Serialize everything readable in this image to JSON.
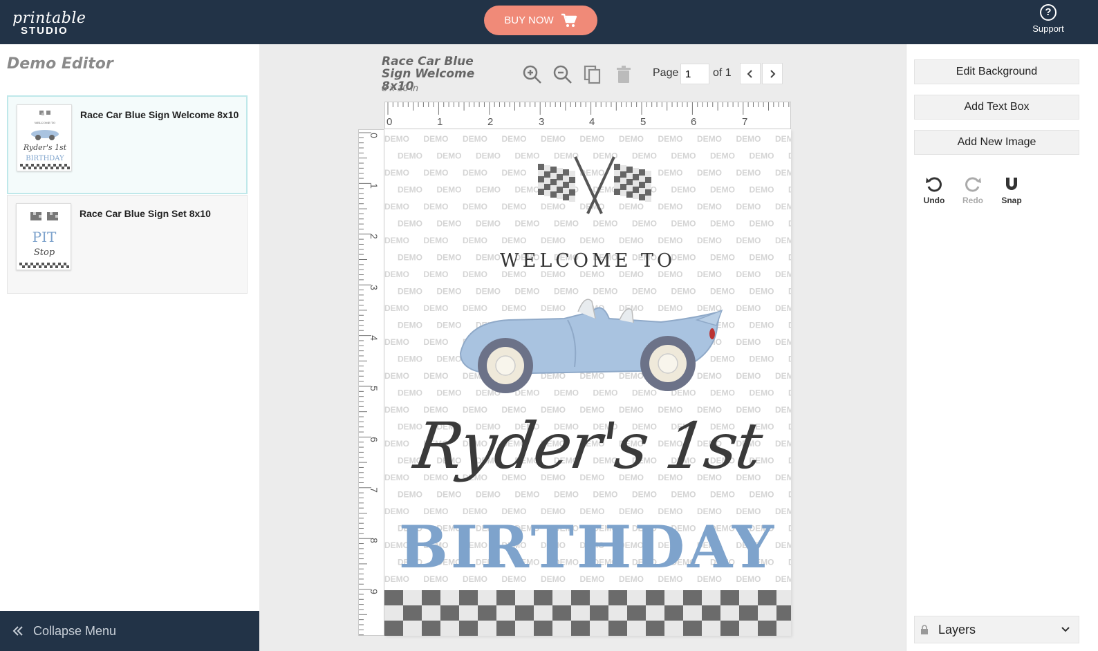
{
  "header": {
    "logo_script": "printable",
    "logo_word": "STUDIO",
    "buy_label": "BUY NOW",
    "support_label": "Support"
  },
  "sidebar": {
    "title": "Demo Editor",
    "templates": [
      {
        "name": "Race Car Blue Sign Welcome 8x10",
        "thumb_lines": [
          "WELCOME TO",
          "Ryder's 1st",
          "BIRTHDAY"
        ]
      },
      {
        "name": "Race Car Blue Sign Set 8x10",
        "thumb_lines": [
          "PIT",
          "Stop"
        ]
      }
    ],
    "collapse_label": "Collapse Menu"
  },
  "editor": {
    "doc_title": "Race Car Blue Sign Welcome 8x10",
    "doc_size": "8 x 10 in",
    "page_label": "Page",
    "page_value": "1",
    "page_of": "of 1",
    "ruler_h": [
      "0",
      "1",
      "2",
      "3",
      "4",
      "5",
      "6",
      "7"
    ],
    "ruler_v": [
      "0",
      "1",
      "2",
      "3",
      "4",
      "5",
      "6",
      "7",
      "8",
      "9"
    ],
    "watermark": "DEMO"
  },
  "canvas": {
    "welcome": "WELCOME TO",
    "name_line": "Ryder's 1st",
    "birthday": "BIRTHDAY"
  },
  "right_panel": {
    "edit_background": "Edit Background",
    "add_text_box": "Add Text Box",
    "add_new_image": "Add New Image",
    "undo": "Undo",
    "redo": "Redo",
    "snap": "Snap",
    "layers": "Layers"
  },
  "colors": {
    "header_bg": "#223347",
    "buy_button": "#f08a78",
    "birthday_text": "#7ea3cc",
    "car_blue": "#a9c3e0"
  }
}
